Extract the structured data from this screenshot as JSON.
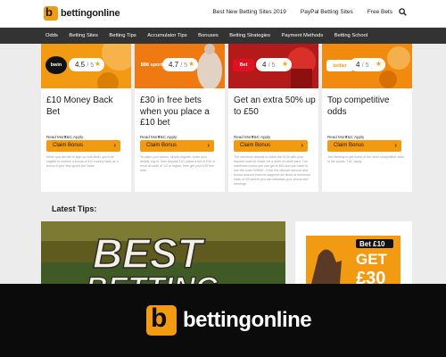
{
  "brand": {
    "name": "bettingonline",
    "mark": "b"
  },
  "top_links": [
    "Best New Betting Sites 2019",
    "PayPal Betting Sites",
    "Free Bets"
  ],
  "nav": [
    "Odds",
    "Betting Sites",
    "Betting Tips",
    "Accumulator Tips",
    "Bonuses",
    "Betting Strategies",
    "Payment Methods",
    "Betting School"
  ],
  "offers": [
    {
      "brand": "bwin",
      "rating": "4.5",
      "of": "/ 5",
      "title": "£10 Money Back Bet",
      "read_more": "Read More",
      "tc": "T&C Apply",
      "cta": "Claim Bonus",
      "small": "When you decide to sign up with Bwin, you'll be eligible to receive a bonus of £10 money back as a bonus if your first sports bet loses.",
      "banner_color": "#f29a12",
      "badge_bg": "#111111",
      "badge_fg": "#ffffff"
    },
    {
      "brand": "888 sport",
      "rating": "4.7",
      "of": "/ 5",
      "title": "£30 in free bets when you place a £10 bet",
      "read_more": "Read More",
      "tc": "T&C Apply",
      "cta": "Claim Bonus",
      "small": "To claim your bonus, simply register, enter your details, log in, then deposit £10, place a bet of £10 or more at odds of 1/2 or higher, then get your £30 free bets.",
      "banner_color": "#f07a12",
      "badge_bg": "#f07a12",
      "badge_fg": "#ffffff"
    },
    {
      "brand": "Bet",
      "rating": "4",
      "of": "/ 5",
      "title": "Get an extra 50% up to £50",
      "read_more": "Read More",
      "tc": "T&C Apply",
      "cta": "Claim Bonus",
      "small": "The minimum deposit to claim the £100 with your deposit must be made via a debit or credit card. The maximum bonus you can get is £50 and you have to use the code 'WIN50'. Once the deposit amount and bonus amount must be wagered six times at minimum odds of 4/5 before you can withdraw your bonus and winnings.",
      "banner_color": "#b51a1a",
      "badge_bg": "#e01020",
      "badge_fg": "#ffffff"
    },
    {
      "brand": "betfair",
      "rating": "4",
      "of": "/ 5",
      "title": "Top competitive odds",
      "read_more": "Read More",
      "tc": "T&C Apply",
      "cta": "Claim Bonus",
      "small": "Join Betway to get some of the most competitive odds in the sports. T&C apply.",
      "banner_color": "#f28a10",
      "badge_bg": "#ffffff",
      "badge_fg": "#f29a12"
    }
  ],
  "latest_tips": {
    "title": "Latest Tips:",
    "hero_text_1": "BEST",
    "hero_text_2": "BETTING"
  },
  "ad": {
    "line1": "Bet £10",
    "line2": "GET",
    "line3": "£30"
  },
  "colors": {
    "accent": "#f29a12",
    "nav_bg": "#333333",
    "overlay_bg": "#0b0b0b"
  }
}
